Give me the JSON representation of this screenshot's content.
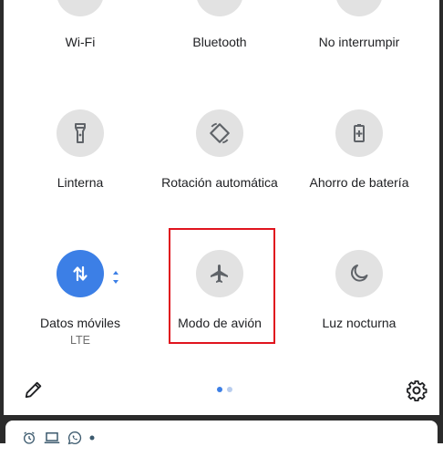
{
  "colors": {
    "tile_inactive": "#e2e2e2",
    "tile_active": "#3c7fe6",
    "highlight": "#e0141e",
    "page_dot_active": "#3c7fe6",
    "page_dot_inactive": "#b9cdee"
  },
  "tiles_row1": [
    {
      "label": "Wi-Fi",
      "icon": "wifi-icon"
    },
    {
      "label": "Bluetooth",
      "icon": "bluetooth-icon"
    },
    {
      "label": "No interrumpir",
      "icon": "do-not-disturb-icon"
    }
  ],
  "tiles_row2": [
    {
      "label": "Linterna",
      "icon": "flashlight-icon"
    },
    {
      "label": "Rotación automática",
      "icon": "auto-rotate-icon"
    },
    {
      "label": "Ahorro de batería",
      "icon": "battery-saver-icon"
    }
  ],
  "tiles_row3": [
    {
      "label": "Datos móviles",
      "sublabel": "LTE",
      "icon": "mobile-data-icon",
      "active": true
    },
    {
      "label": "Modo de avión",
      "icon": "airplane-icon",
      "highlighted": true
    },
    {
      "label": "Luz nocturna",
      "icon": "moon-icon"
    }
  ],
  "footer": {
    "edit_icon": "pencil-icon",
    "settings_icon": "gear-icon",
    "pages": 2,
    "current_page": 1
  },
  "notification_icons": [
    "alarm-icon",
    "laptop-icon",
    "whatsapp-icon",
    "dot-icon"
  ]
}
